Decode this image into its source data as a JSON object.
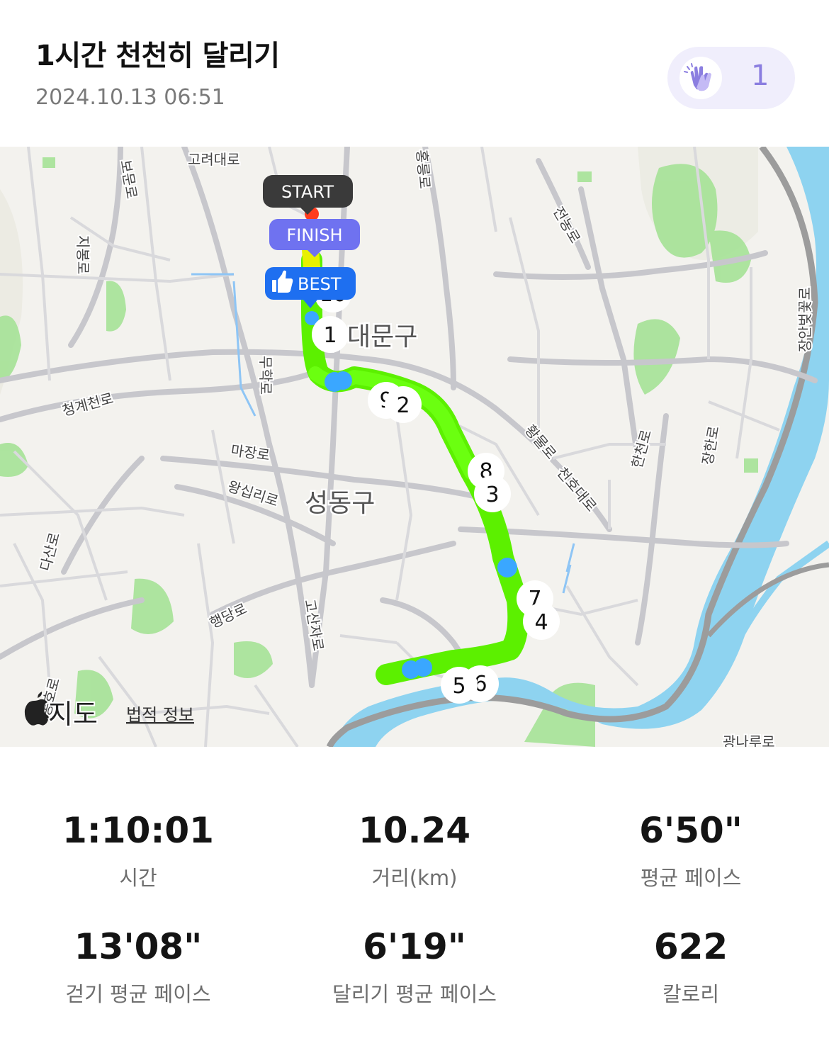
{
  "header": {
    "title": "1시간 천천히 달리기",
    "datetime": "2024.10.13 06:51",
    "clap_icon": "clapping-hands-icon",
    "clap_count": "1"
  },
  "map": {
    "markers": {
      "start": "START",
      "finish": "FINISH",
      "best": "BEST"
    },
    "districts": [
      "대문구",
      "성동구"
    ],
    "roads": [
      "고려대로",
      "보문로",
      "지봉로",
      "청계천로",
      "마장로",
      "왕십리로",
      "무학로",
      "다산로",
      "행당로",
      "고산자로",
      "황물로",
      "천호대로",
      "한천로",
      "장한로",
      "장안벚꽃로",
      "전농로",
      "홍릉로",
      "광나루로",
      "동호로"
    ],
    "km_markers": [
      "1",
      "2",
      "3",
      "4",
      "5",
      "6",
      "7",
      "8",
      "9",
      "10"
    ],
    "attribution": {
      "logo": "apple-logo-icon",
      "label": "지도",
      "legal": "법적 정보"
    },
    "colors": {
      "route": "#5cf000",
      "route_fast": "#3aa7ff",
      "route_slow": "#e8f000",
      "river": "#8ed3f0",
      "park": "#a9e39a",
      "badge_best": "#1e6ff0",
      "badge_finish": "#6f72f0",
      "badge_start": "#3a3a3a"
    }
  },
  "stats": [
    {
      "value": "1:10:01",
      "label": "시간"
    },
    {
      "value": "10.24",
      "label": "거리(km)"
    },
    {
      "value": "6'50\"",
      "label": "평균 페이스"
    },
    {
      "value": "13'08\"",
      "label": "걷기 평균 페이스"
    },
    {
      "value": "6'19\"",
      "label": "달리기 평균 페이스"
    },
    {
      "value": "622",
      "label": "칼로리"
    }
  ]
}
